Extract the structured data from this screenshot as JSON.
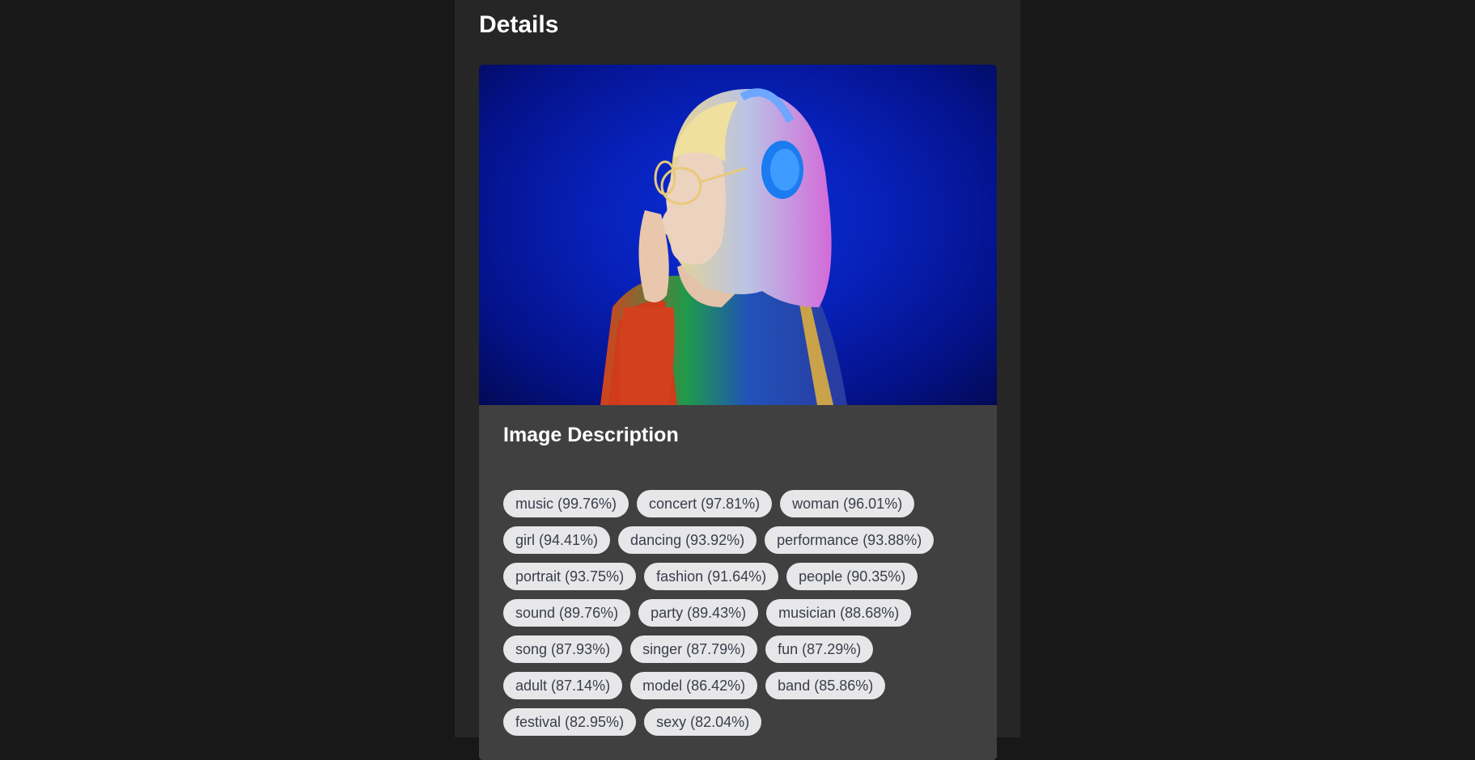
{
  "page": {
    "title": "Details"
  },
  "image_card": {
    "photo_subject": "woman-with-headphones",
    "heading": "Image Description",
    "tags": [
      "music (99.76%)",
      "concert (97.81%)",
      "woman (96.01%)",
      "girl (94.41%)",
      "dancing (93.92%)",
      "performance (93.88%)",
      "portrait (93.75%)",
      "fashion (91.64%)",
      "people (90.35%)",
      "sound (89.76%)",
      "party (89.43%)",
      "musician (88.68%)",
      "song (87.93%)",
      "singer (87.79%)",
      "fun (87.29%)",
      "adult (87.14%)",
      "model (86.42%)",
      "band (85.86%)",
      "festival (82.95%)",
      "sexy (82.04%)"
    ]
  },
  "colors": {
    "background": "#181818",
    "panel": "#262626",
    "card": "#404040",
    "tag_bg": "#e7e7ea",
    "tag_text": "#3a3e4a",
    "photo_backdrop": "#0720b8"
  }
}
